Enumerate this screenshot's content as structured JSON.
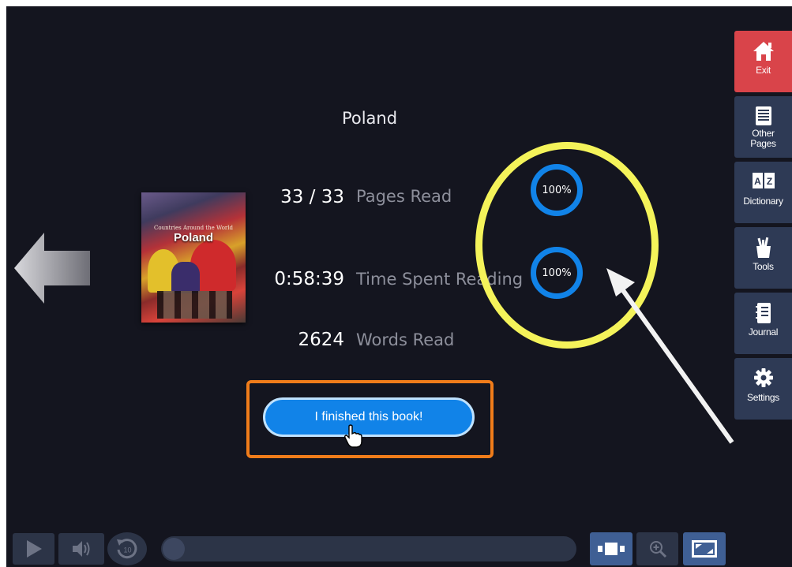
{
  "book": {
    "title": "Poland",
    "cover_subtitle": "Countries Around the World",
    "cover_title": "Poland"
  },
  "stats": {
    "pages_value": "33 / 33",
    "pages_label": "Pages Read",
    "pages_percent": "100%",
    "time_value": "0:58:39",
    "time_label": "Time Spent Reading",
    "time_percent": "100%",
    "words_value": "2624",
    "words_label": "Words Read"
  },
  "finish_button_label": "I finished this book!",
  "sidebar": {
    "exit": "Exit",
    "other_pages_line1": "Other",
    "other_pages_line2": "Pages",
    "dictionary": "Dictionary",
    "tools": "Tools",
    "journal": "Journal",
    "settings": "Settings"
  },
  "player": {
    "replay_seconds": "10",
    "progress_fraction": 0.0
  },
  "colors": {
    "background": "#14151f",
    "accent_blue": "#1183e8",
    "exit_red": "#d9444a",
    "sidebar_navy": "#2e3a55",
    "annotation_yellow": "#f4f35a",
    "annotation_orange": "#f07c1a"
  },
  "icons": [
    "back-arrow-icon",
    "home-icon",
    "list-icon",
    "dictionary-icon",
    "tools-icon",
    "journal-icon",
    "gear-icon",
    "play-icon",
    "speaker-icon",
    "replay-10-icon",
    "view-mode-icon",
    "zoom-in-icon",
    "fullscreen-icon",
    "hand-pointer-icon"
  ]
}
